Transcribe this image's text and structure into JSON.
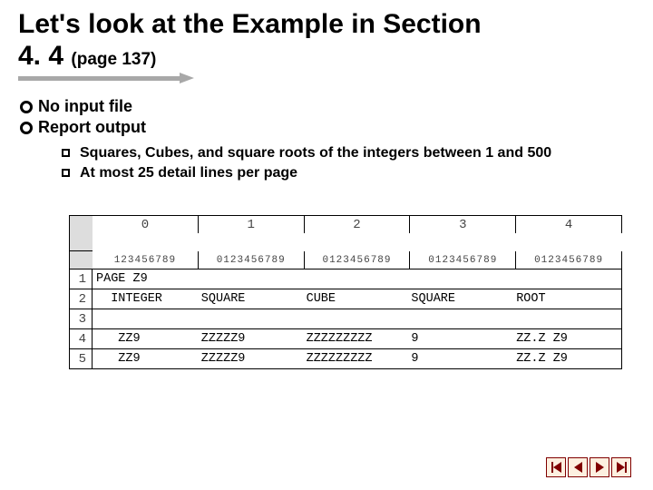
{
  "title": {
    "line1": "Let's look at the Example in Section",
    "line2_main": "4. 4",
    "line2_ref": "(page 137)"
  },
  "bullets": {
    "level1": [
      "No input file",
      "Report output"
    ],
    "level2": [
      "Squares, Cubes, and square roots of the integers between 1 and 500",
      "At most 25 detail lines per page"
    ]
  },
  "layout": {
    "cols": [
      "0",
      "1",
      "2",
      "3",
      "4"
    ],
    "digits": "123456789",
    "digits0": "0123456789",
    "rows": [
      {
        "n": "1",
        "c": [
          "PAGE Z9",
          "",
          "",
          "",
          ""
        ]
      },
      {
        "n": "2",
        "c": [
          "  INTEGER",
          "SQUARE",
          "CUBE",
          "SQUARE",
          "ROOT"
        ]
      },
      {
        "n": "3",
        "c": [
          "",
          "",
          "",
          "",
          ""
        ]
      },
      {
        "n": "4",
        "c": [
          "   ZZ9",
          "ZZZZZ9",
          "ZZZZZZZZZ",
          "9",
          "ZZ.Z Z9"
        ]
      },
      {
        "n": "5",
        "c": [
          "   ZZ9",
          "ZZZZZ9",
          "ZZZZZZZZZ",
          "9",
          "ZZ.Z Z9"
        ]
      }
    ]
  },
  "nav": {
    "first": "first-slide",
    "prev": "previous-slide",
    "next": "next-slide",
    "last": "last-slide"
  }
}
